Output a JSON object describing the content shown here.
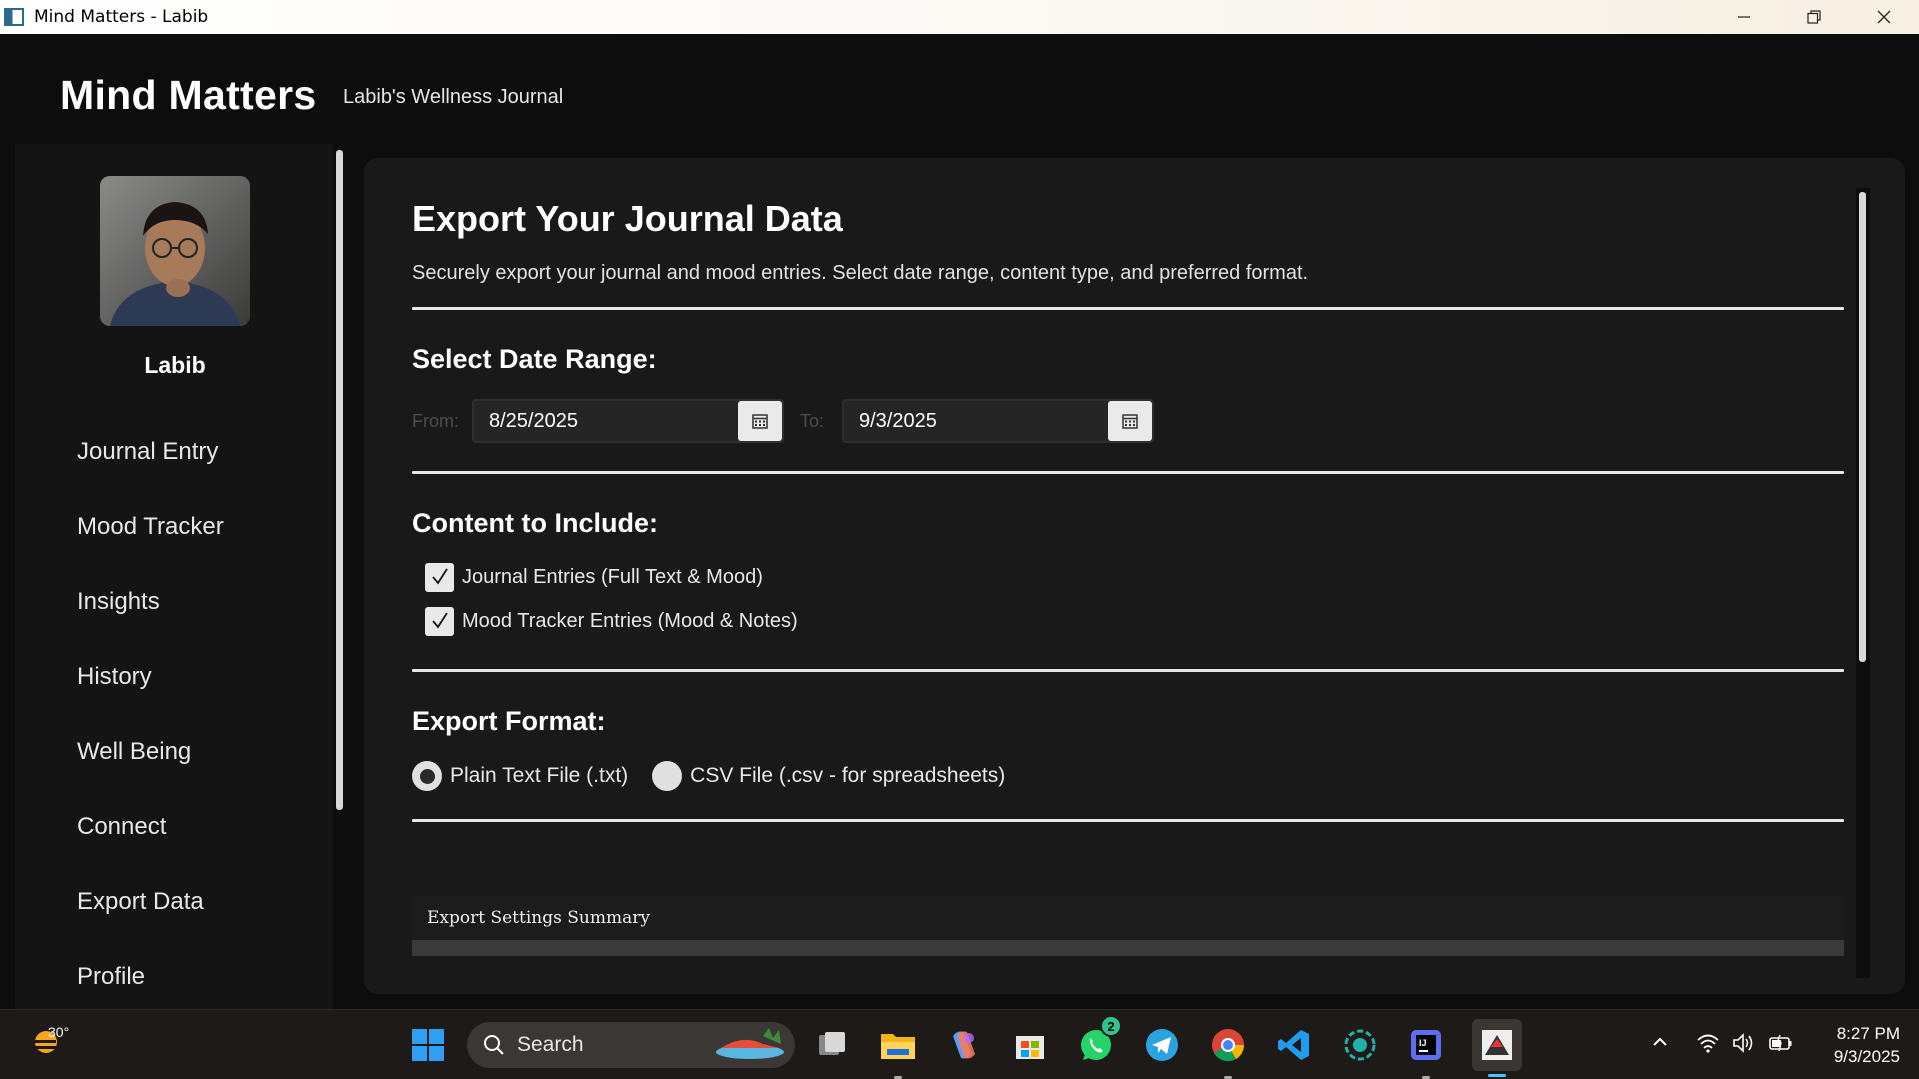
{
  "window": {
    "title": "Mind Matters - Labib",
    "controls": [
      "minimize-icon",
      "restore-icon",
      "close-icon"
    ]
  },
  "header": {
    "app_title": "Mind Matters",
    "subtitle": "Labib's Wellness Journal"
  },
  "sidebar": {
    "user_name": "Labib",
    "items": [
      {
        "label": "Journal Entry"
      },
      {
        "label": "Mood Tracker"
      },
      {
        "label": "Insights"
      },
      {
        "label": "History"
      },
      {
        "label": "Well Being"
      },
      {
        "label": "Connect"
      },
      {
        "label": "Export Data"
      },
      {
        "label": "Profile"
      }
    ]
  },
  "main": {
    "title": "Export Your Journal Data",
    "description": "Securely export your journal and mood entries. Select date range, content type, and preferred format.",
    "date_range": {
      "title": "Select Date Range:",
      "from_label": "From:",
      "from_value": "8/25/2025",
      "to_label": "To:",
      "to_value": "9/3/2025"
    },
    "content": {
      "title": "Content to Include:",
      "options": [
        {
          "label": "Journal Entries (Full Text & Mood)",
          "checked": true
        },
        {
          "label": "Mood Tracker Entries (Mood & Notes)",
          "checked": true
        }
      ]
    },
    "format": {
      "title": "Export Format:",
      "options": [
        {
          "label": "Plain Text File (.txt)",
          "selected": true
        },
        {
          "label": "CSV File (.csv - for spreadsheets)",
          "selected": false
        }
      ]
    },
    "summary": {
      "label": "Export Settings Summary"
    }
  },
  "taskbar": {
    "weather_temp": "30°",
    "search_placeholder": "Search",
    "whatsapp_badge": "2",
    "clock_time": "8:27 PM",
    "clock_date": "9/3/2025",
    "colors": {
      "accent": "#30c48a",
      "background": "#1d1a17"
    }
  }
}
